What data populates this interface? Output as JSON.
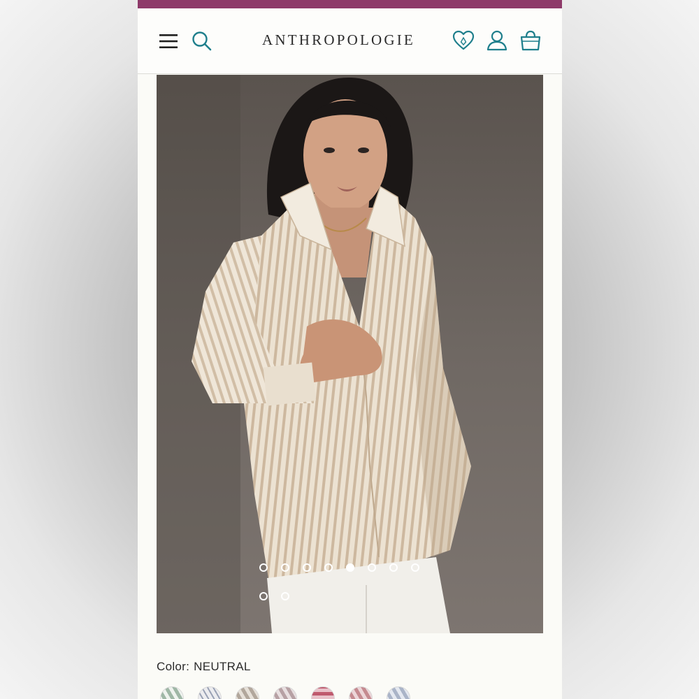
{
  "app": {
    "brand": "ANTHROPOLOGIE",
    "accent_color": "#8e3a6a",
    "icon_color": "#1f7f8c"
  },
  "header": {
    "menu_icon": "hamburger-menu-icon",
    "search_icon": "search-icon",
    "wishlist_icon": "heart-icon",
    "account_icon": "user-icon",
    "bag_icon": "shopping-bag-icon"
  },
  "gallery": {
    "image": "model wearing neutral striped button-down shirt",
    "image_count": 10,
    "active_index": 4
  },
  "product": {
    "color_label": "Color:",
    "color_value": "NEUTRAL",
    "swatch_colors": [
      "#9fb7a6",
      "#ececef",
      "#b2a79c",
      "#b7a1a4",
      "#c05a6e",
      "#c58a90",
      "#aab4c8"
    ]
  }
}
